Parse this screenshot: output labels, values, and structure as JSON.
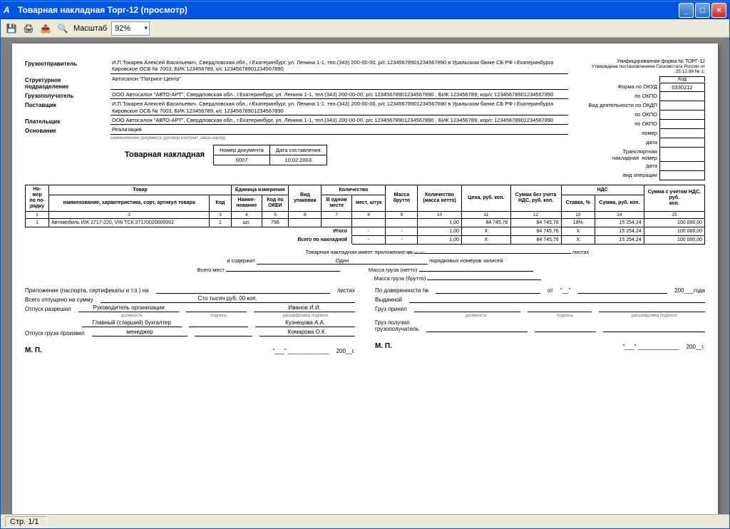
{
  "window": {
    "title": "Товарная накладная Торг-12 (просмотр)",
    "zoom_label": "Масштаб",
    "zoom_value": "92%"
  },
  "form": {
    "form_id": "Унифицированная форма № ТОРГ-12",
    "approved": "Утверждена постановлением Госкомстата России от 25.12.98 № 1:",
    "kod_title": "Код",
    "codes": {
      "okud_lbl": "Форма по ОКУД",
      "okud_val": "0330212",
      "okpo1_lbl": "по ОКПО",
      "okpo1_val": "",
      "okdp_lbl": "Вид деятельности по ОКДП",
      "okdp_val": "",
      "okpo2_lbl": "по ОКПО",
      "okpo2_val": "",
      "okpo3_lbl": "по ОКПО",
      "okpo3_val": "",
      "num_lbl": "номер",
      "num_val": "",
      "date_lbl": "дата",
      "date_val": "",
      "trans_lbl": "Транспортная накладная",
      "num2_lbl": "номер",
      "num2_val": "",
      "date2_lbl": "дата",
      "date2_val": "",
      "op_lbl": "вид операции",
      "op_val": ""
    },
    "parties": {
      "shipper_lbl": "Грузоотправитель",
      "shipper": "И.П.Токарев Алексей Васильевич, Свердловская обл., г.Екатеринбург, ул. Ленина 1-1, тел.(343) 200-00-00, р/с 12345678901234567890 в Уральском банке СБ РФ г.Екатеринбурга Кировское ОСБ № 7003, БИК 123456789, к/с 12345678901234567890",
      "unit_lbl": "Структурное подразделение",
      "unit": "Автосалон \"Патриот-Центр\"",
      "consignee_lbl": "Грузополучатель",
      "consignee": "ООО Автосалон \"АВТО-АРТ\", Свердловская обл., г.Екатеринбург, ул. Ленина 1-1, тел.(343) 200-00-00, р/с 12345678901234567890 , БИК 123456789, кор/с 12345678901234567890",
      "supplier_lbl": "Поставщик",
      "supplier": "И.П.Токарев Алексей Васильевич, Свердловская обл., г.Екатеринбург, ул. Ленина 1-1, тел.(343) 200-00-00, р/с 12345678901234567890 в Уральском банке СБ РФ г.Екатеринбурга Кировское ОСБ № 7003, БИК 123456789, к/с 12345678901234567890",
      "payer_lbl": "Плательщик",
      "payer": "ООО Автосалон \"АВТО-АРТ\", Свердловская обл., г.Екатеринбург, ул. Ленина 1-1, тел.(343) 200-00-00, р/с 12345678901234567890 , БИК 123456789, кор/с 12345678901234567890",
      "basis_lbl": "Основание",
      "basis": "Реализация",
      "basis_hint": "наименование документа (договор контракт, заказ-наряд)"
    },
    "doc": {
      "title": "Товарная накладная",
      "num_h": "Номер документа",
      "num": "0007",
      "date_h": "Дата составления",
      "date": "10.02.2003"
    },
    "headers": {
      "h1a": "Но-",
      "h1b": "мер",
      "h1c": "по по-",
      "h1d": "рядку",
      "h2": "Товар",
      "h2a": "наименование, характеристика, сорт, артикул товара",
      "h2b": "Код",
      "h3": "Единица измерения",
      "h3a": "Наиме-",
      "h3a2": "нование",
      "h3b": "Код по",
      "h3b2": "ОКЕИ",
      "h4": "Вид",
      "h4b": "упаковки",
      "h5": "Количество",
      "h5a": "В одном",
      "h5a2": "месте",
      "h5b": "мест, штук",
      "h6": "Масса",
      "h6b": "брутто",
      "h7": "Количество",
      "h7b": "(масса нетто)",
      "h8": "Цена, руб. коп.",
      "h9": "Сумма без учета",
      "h9b": "НДС, руб. коп.",
      "h10": "НДС",
      "h10a": "Ставка, %",
      "h10b": "Сумма, руб. коп.",
      "h11": "Сумма с учетом НДС, руб.",
      "h11b": "коп."
    },
    "colnums": [
      "1",
      "2",
      "3",
      "4",
      "5",
      "6",
      "7",
      "8",
      "9",
      "10",
      "11",
      "12",
      "13",
      "14",
      "15"
    ],
    "rows": [
      {
        "n": "1",
        "name": "Автомобиль ИЖ 2717-220, VIN ТСК 27170020000002",
        "code": "1",
        "unit": "шт.",
        "okei": "796",
        "pack": "",
        "inone": "",
        "places": "",
        "brutto": "",
        "qty": "1,00",
        "price": "84 745,76",
        "sum": "84 745,76",
        "rate": "18%",
        "nds": "15 254,24",
        "total": "100 000,00"
      }
    ],
    "itogo_lbl": "Итого",
    "vsego_lbl": "Всего по накладной",
    "totals": {
      "places": "-",
      "brutto": "-",
      "qty": "1,00",
      "price": "X",
      "sum": "84 745,76",
      "rate": "X",
      "nds": "15 254,24",
      "total": "100 000,00"
    },
    "below": {
      "att_lbl": "Товарная накладная имеет приложение на",
      "sheets_lbl": "листах",
      "contains_lbl": "и содержит",
      "contains_val": "Один",
      "records_lbl": "порядковых номеров записей",
      "places_lbl": "Всего мест",
      "mass_net_lbl": "Масса груза (нетто)",
      "mass_gross_lbl": "Масса груза (брутто)",
      "propis": "прописью"
    },
    "sig": {
      "app_lbl": "Приложение (паспорта, сертификаты и т.п.) на",
      "app_sheets": "листах",
      "released_sum_lbl": "Всего отпущено на сумму",
      "released_sum": "Сто  тысяч  руб. 00  коп.",
      "allow_lbl": "Отпуск разрешил",
      "pos1": "Руководитель организации",
      "name1": "Иванов И.И.",
      "chief_acc_lbl": "Главный (старший) бухгалтер",
      "name2": "Кузнецова А.А.",
      "release_done_lbl": "Отпуск груза произвел",
      "pos3": "менеджер",
      "name3": "Комарова О.К.",
      "mp": "М. П.",
      "date_tail": "200__г.",
      "by_proxy": "По доверенности №",
      "from": "от",
      "year": "200___года",
      "issued": "Выданной",
      "received": "Груз принял",
      "received2a": "Груз получил",
      "received2b": "грузополучатель",
      "hint_pos": "должность",
      "hint_sign": "подпись",
      "hint_name": "расшифровка подписи"
    }
  },
  "status": {
    "page": "Стр. 1/1"
  }
}
